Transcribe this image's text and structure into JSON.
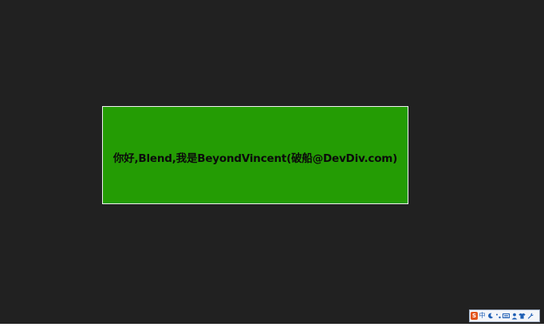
{
  "panel": {
    "greeting": "你好,Blend,我是BeyondVincent(破船@DevDiv.com)"
  },
  "ime_toolbar": {
    "logo_letter": "S",
    "mode_label": "中",
    "icons": [
      "logo-icon",
      "chinese-mode-icon",
      "half-width-moon-icon",
      "punctuation-icon",
      "soft-keyboard-icon",
      "user-icon",
      "skin-shirt-icon",
      "wrench-settings-icon"
    ]
  },
  "colors": {
    "background": "#212121",
    "panel": "#249c04",
    "panel_border": "#f2f2f2",
    "text": "#0b0b0b"
  }
}
